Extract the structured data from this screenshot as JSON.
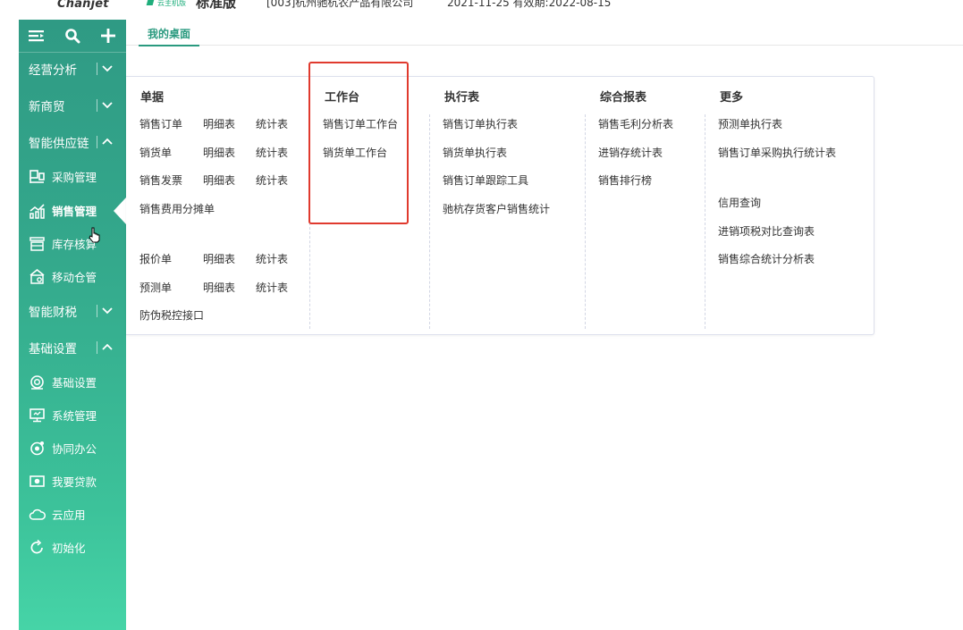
{
  "header": {
    "logo": "Chanjet",
    "edition_small": "云主机版",
    "edition_big": "标准版",
    "company": "[003]杭州驰杭农产品有限公司",
    "date_info": "2021-11-25   有效期:2022-08-15"
  },
  "sidebar": {
    "tools": [
      "menu-icon",
      "search-icon",
      "plus-icon"
    ],
    "sections": {
      "jingying": "经营分析",
      "xinshangmao": "新商贸",
      "gongyinglian": "智能供应链",
      "caishui": "智能财税",
      "jichu": "基础设置"
    },
    "items": {
      "caigou": "采购管理",
      "xiaoshou": "销售管理",
      "kucun": "库存核算",
      "yidong": "移动仓管",
      "jichushezhi": "基础设置",
      "xitong": "系统管理",
      "xietong": "协同办公",
      "daikuan": "我要贷款",
      "yun": "云应用",
      "chushihua": "初始化"
    }
  },
  "tabs": {
    "desktop": "我的桌面"
  },
  "menu": {
    "danju": {
      "title": "单据",
      "xsdd": "销售订单",
      "xsdd_mx": "明细表",
      "xsdd_tj": "统计表",
      "xhd": "销货单",
      "xhd_mx": "明细表",
      "xhd_tj": "统计表",
      "xsfp": "销售发票",
      "xsfp_mx": "明细表",
      "xsfp_tj": "统计表",
      "fyft": "销售费用分摊单",
      "bjd": "报价单",
      "bjd_mx": "明细表",
      "bjd_tj": "统计表",
      "ycd": "预测单",
      "ycd_mx": "明细表",
      "ycd_tj": "统计表",
      "fwsk": "防伪税控接口"
    },
    "gongzuotai": {
      "title": "工作台",
      "xsddgzt": "销售订单工作台",
      "xhdgzt": "销货单工作台"
    },
    "zhixingbiao": {
      "title": "执行表",
      "i1": "销售订单执行表",
      "i2": "销货单执行表",
      "i3": "销售订单跟踪工具",
      "i4": "驰杭存货客户销售统计"
    },
    "zonghe": {
      "title": "综合报表",
      "i1": "销售毛利分析表",
      "i2": "进销存统计表",
      "i3": "销售排行榜"
    },
    "gengduo": {
      "title": "更多",
      "i1": "预测单执行表",
      "i2": "销售订单采购执行统计表",
      "i3": "信用查询",
      "i4": "进销项税对比查询表",
      "i5": "销售综合统计分析表"
    }
  },
  "colors": {
    "accent": "#2a9a7f",
    "sidebar_top": "#2f9a84",
    "sidebar_bottom": "#46d4a7",
    "highlight": "#e03a2e"
  }
}
